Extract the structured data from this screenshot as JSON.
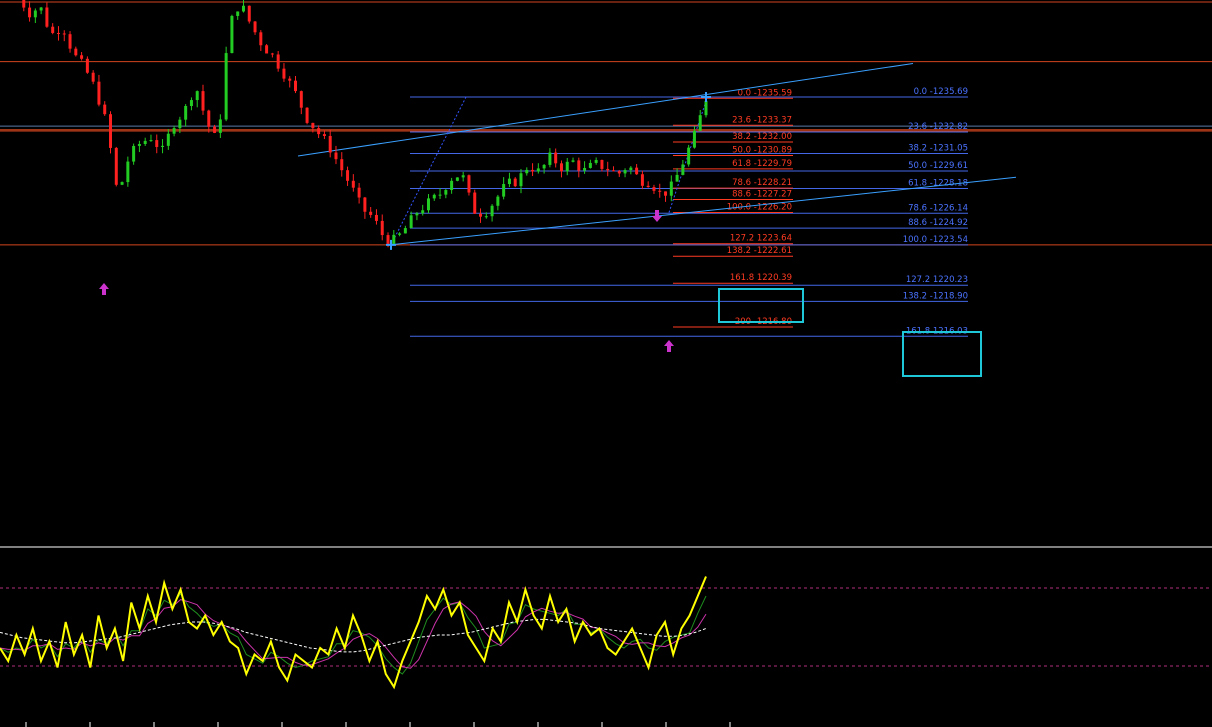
{
  "colors": {
    "background": "#000000",
    "bull_candle": "#22cc22",
    "bear_candle": "#ff2020",
    "orange_level": "#d2451e",
    "channel": "#1e90ff",
    "fib_red": "#ff3b22",
    "fib_blue": "#4b73ff",
    "highlight_box": "#1ec8d8",
    "arrow_marker": "#cc33cc",
    "osc_main": "#ffff00",
    "osc_signal": "#ffffff",
    "osc_green": "#1e8c1e",
    "osc_pink": "#cc33aa"
  },
  "chart_data": [
    {
      "type": "candlestick",
      "title": "",
      "xlabel": "",
      "ylabel": "",
      "grid": false,
      "price_range": [
        1214.5,
        1243.6
      ],
      "horizontal_levels": [
        1243.5,
        1238.6,
        1233.0,
        1232.9,
        1223.54
      ],
      "channel": {
        "upper": [
          [
            298,
            1230.85
          ],
          [
            913,
            1238.45
          ]
        ],
        "lower": [
          [
            390,
            1223.54
          ],
          [
            1016,
            1229.1
          ]
        ]
      },
      "ohlc_envelope_close": [
        1244.0,
        1242.6,
        1243.1,
        1240.8,
        1241.6,
        1239.2,
        1238.1,
        1236.3,
        1233.4,
        1227.5,
        1230.8,
        1231.9,
        1232.4,
        1231.2,
        1233.5,
        1234.5,
        1236.7,
        1233.6,
        1231.9,
        1241.5,
        1243.5,
        1241.6,
        1240.0,
        1239.0,
        1237.6,
        1236.0,
        1234.0,
        1232.8,
        1231.7,
        1230.0,
        1228.4,
        1226.5,
        1225.8,
        1224.1,
        1223.9,
        1225.0,
        1226.3,
        1227.0,
        1227.7,
        1229.0,
        1229.4,
        1226.4,
        1226.1,
        1227.2,
        1228.5,
        1228.8,
        1230.1,
        1229.5,
        1230.8,
        1229.9,
        1230.4,
        1229.6,
        1230.2,
        1229.9,
        1229.3,
        1230.1,
        1228.9,
        1228.7,
        1227.6,
        1228.4,
        1230.5,
        1232.6,
        1235.6
      ],
      "markers": [
        {
          "kind": "up-arrow",
          "price": 1226.9,
          "index_hint": "left-low"
        },
        {
          "kind": "down-arrow",
          "price": 1232.4,
          "index_hint": "recent-high"
        },
        {
          "kind": "up-arrow",
          "price": 1226.1,
          "index_hint": "recent-low"
        },
        {
          "kind": "cross",
          "price": 1223.54,
          "index_hint": "swing-low"
        },
        {
          "kind": "cross",
          "price": 1235.69,
          "index_hint": "swing-high"
        }
      ]
    },
    {
      "type": "line",
      "title": "",
      "series": [
        {
          "values": [
            40,
            30,
            50,
            35,
            55,
            30,
            45,
            25,
            60,
            35,
            50,
            25,
            65,
            40,
            55,
            30,
            75,
            55,
            80,
            60,
            90,
            70,
            85,
            60,
            55,
            65,
            50,
            60,
            45,
            40,
            20,
            35,
            30,
            45,
            25,
            15,
            35,
            30,
            25,
            40,
            35,
            55,
            40,
            65,
            50,
            30,
            45,
            20,
            10,
            30,
            45,
            60,
            80,
            70,
            85,
            65,
            75,
            50,
            40,
            30,
            55,
            45,
            75,
            60,
            85,
            65,
            55,
            80,
            60,
            70,
            45,
            60,
            50,
            55,
            40,
            35,
            45,
            55,
            40,
            25,
            50,
            60,
            35,
            55,
            65,
            80,
            95
          ]
        },
        {
          "values": [
            52,
            50,
            48,
            47,
            46,
            45,
            44,
            44,
            45,
            46,
            47,
            48,
            50,
            52,
            54,
            56,
            58,
            59,
            60,
            60,
            59,
            57,
            55,
            52,
            50,
            48,
            46,
            44,
            42,
            40,
            39,
            38,
            37,
            37,
            38,
            40,
            42,
            44,
            46,
            48,
            49,
            50,
            50,
            51,
            52,
            54,
            56,
            58,
            60,
            61,
            62,
            62,
            61,
            60,
            59,
            57,
            55,
            54,
            53,
            52,
            51,
            50,
            49,
            49,
            50,
            52,
            55
          ]
        }
      ],
      "levels": [
        80,
        20
      ]
    }
  ],
  "fib_red": [
    {
      "label": "0.0 -1235.59",
      "price": 1235.59
    },
    {
      "label": "23.6 -1233.37",
      "price": 1233.37
    },
    {
      "label": "38.2 -1232.00",
      "price": 1232.0
    },
    {
      "label": "50.0 -1230.89",
      "price": 1230.89
    },
    {
      "label": "61.8 -1229.79",
      "price": 1229.79
    },
    {
      "label": "78.6 -1228.21",
      "price": 1228.21
    },
    {
      "label": "88.6 -1227.27",
      "price": 1227.27
    },
    {
      "label": "100.0 -1226.20",
      "price": 1226.2
    },
    {
      "label": "127.2 1223.64",
      "price": 1223.64
    },
    {
      "label": "138.2 -1222.61",
      "price": 1222.61
    },
    {
      "label": "161.8 1220.39",
      "price": 1220.39
    },
    {
      "label": "200- 1216.80",
      "price": 1216.8
    }
  ],
  "fib_blue": [
    {
      "label": "0.0 -1235.69",
      "price": 1235.69
    },
    {
      "label": "23.6 -1232.82",
      "price": 1232.82
    },
    {
      "label": "38.2 -1231.05",
      "price": 1231.05
    },
    {
      "label": "50.0 -1229.61",
      "price": 1229.61
    },
    {
      "label": "61.8 -1228.18",
      "price": 1228.18
    },
    {
      "label": "78.6 -1226.14",
      "price": 1226.14
    },
    {
      "label": "88.6 -1224.92",
      "price": 1224.92
    },
    {
      "label": "100.0 -1223.54",
      "price": 1223.54
    },
    {
      "label": "127.2 1220.23",
      "price": 1220.23
    },
    {
      "label": "138.2  -1218.90",
      "price": 1218.9
    },
    {
      "label": "161.8 1216.03",
      "price": 1216.03
    }
  ]
}
